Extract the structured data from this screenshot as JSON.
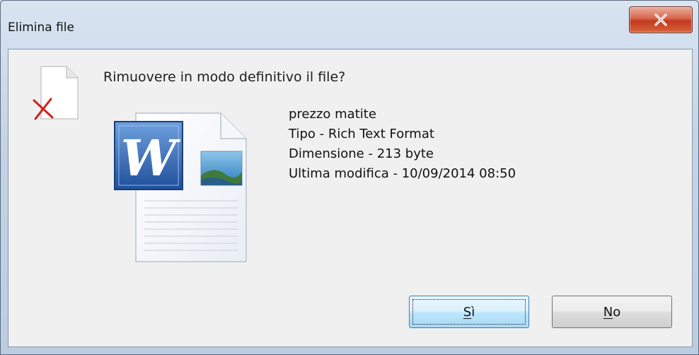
{
  "window": {
    "title": "Elimina file",
    "close_label": "X"
  },
  "dialog": {
    "question": "Rimuovere in modo definitivo il file?",
    "file": {
      "name": "prezzo matite",
      "type": "Tipo - Rich Text Format",
      "size": "Dimensione - 213 byte",
      "modified": "Ultima modifica - 10/09/2014 08:50"
    },
    "icons": {
      "warning": "delete-file-icon",
      "document": "word-document-icon"
    }
  },
  "buttons": {
    "yes": {
      "label": "Sì",
      "accel": "S",
      "rest": "ì"
    },
    "no": {
      "label": "No",
      "accel": "N",
      "rest": "o"
    }
  },
  "colors": {
    "title_bar": "#c4d3e6",
    "close_button": "#c2391d",
    "client_bg": "#f0f0f0",
    "default_button_border": "#3c7fb1"
  }
}
